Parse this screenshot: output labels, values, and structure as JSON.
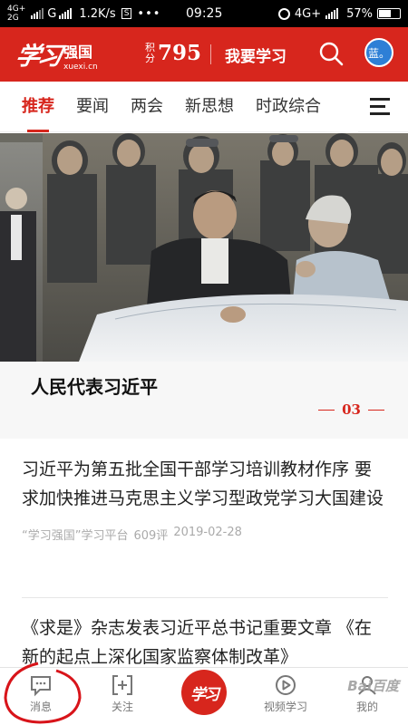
{
  "status_bar": {
    "network_top": "4G+",
    "network_bottom": "2G",
    "carrier_mark": "G",
    "speed": "1.2K/s",
    "s_badge": "S",
    "dots": "•••",
    "time": "09:25",
    "right_network": "4G+",
    "battery": "57%",
    "battery_level": 0.57
  },
  "header": {
    "logo_script": "学习",
    "logo_name": "强国",
    "logo_url": "xuexi.cn",
    "points_label": "积分",
    "points_value": "795",
    "study_button": "我要学习",
    "avatar_text": "蓝。",
    "brand_color": "#d7261d"
  },
  "tabs": {
    "items": [
      {
        "label": "推荐"
      },
      {
        "label": "要闻"
      },
      {
        "label": "两会"
      },
      {
        "label": "新思想"
      },
      {
        "label": "时政综合"
      }
    ],
    "active_index": 0
  },
  "banner": {
    "title": "人民代表习近平",
    "page_number": "03"
  },
  "articles": [
    {
      "title": "习近平为第五批全国干部学习培训教材作序 要求加快推进马克思主义学习型政党学习大国建设",
      "source": "“学习强国”学习平台",
      "comments": "609评",
      "date": "2019-02-28"
    },
    {
      "title": "《求是》杂志发表习近平总书记重要文章 《在新的起点上深化国家监察体制改革》"
    }
  ],
  "bottom_nav": {
    "messages": "消息",
    "follow": "关注",
    "center_logo": "学习",
    "video": "视频学习",
    "mine": "我的"
  },
  "watermark": "Bai百度"
}
